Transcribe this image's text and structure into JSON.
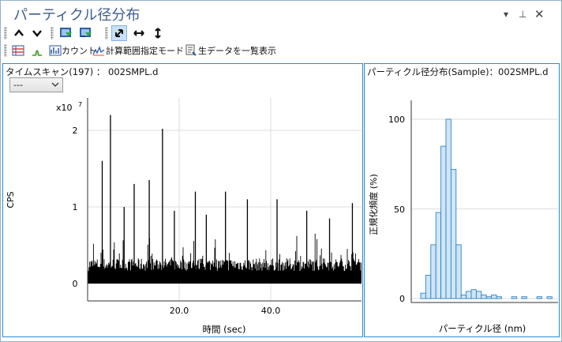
{
  "window": {
    "title": "パーティクル径分布"
  },
  "toolbar1": {
    "items": [
      "up-arrow",
      "down-arrow",
      "export-green",
      "export-blue",
      "autoscale",
      "expand-horizontal",
      "expand-vertical"
    ]
  },
  "toolbar2": {
    "count_label": "カウント",
    "calc_range_label": "計算範囲指定モード",
    "raw_data_label": "生データを一覧表示"
  },
  "time_scan_panel": {
    "title": "タイムスキャン(197) ： 002SMPL.d",
    "dropdown_value": "---",
    "y_label": "CPS",
    "y_multiplier": "x10",
    "y_exponent": "7",
    "x_label": "時間 (sec)",
    "y_ticks": [
      "0",
      "1",
      "2"
    ],
    "x_ticks": [
      "20.0",
      "40.0"
    ]
  },
  "histogram_panel": {
    "title": "パーティクル径分布(Sample)：002SMPL.d",
    "y_label": "正規化頻度 (%)",
    "x_label": "パーティクル径 (nm)",
    "y_ticks": [
      "0",
      "50",
      "100"
    ]
  },
  "chart_data": [
    {
      "type": "line",
      "title": "タイムスキャン(197) ： 002SMPL.d",
      "xlabel": "時間 (sec)",
      "ylabel": "CPS",
      "y_scale_note": "x10^7",
      "xlim": [
        0,
        60
      ],
      "ylim": [
        -0.1,
        2.4
      ],
      "baseline": 0.3,
      "spikes": [
        {
          "x": 5.0,
          "y": 2.2
        },
        {
          "x": 3.2,
          "y": 1.6
        },
        {
          "x": 16.4,
          "y": 2.02
        },
        {
          "x": 13.5,
          "y": 1.35
        },
        {
          "x": 10.2,
          "y": 1.3
        },
        {
          "x": 23.6,
          "y": 1.2
        },
        {
          "x": 30.2,
          "y": 1.2
        },
        {
          "x": 35.0,
          "y": 1.1
        },
        {
          "x": 41.5,
          "y": 1.1
        },
        {
          "x": 58.0,
          "y": 1.05
        },
        {
          "x": 8.0,
          "y": 1.0
        },
        {
          "x": 19.0,
          "y": 0.95
        },
        {
          "x": 26.0,
          "y": 0.9
        },
        {
          "x": 48.0,
          "y": 0.95
        },
        {
          "x": 53.0,
          "y": 0.85
        }
      ]
    },
    {
      "type": "bar",
      "title": "パーティクル径分布(Sample)：002SMPL.d",
      "xlabel": "パーティクル径 (nm)",
      "ylabel": "正規化頻度 (%)",
      "ylim": [
        0,
        120
      ],
      "values": [
        3,
        13,
        30,
        48,
        85,
        100,
        72,
        30,
        2,
        4,
        5,
        4,
        2,
        1,
        2,
        1,
        0,
        0,
        1,
        0,
        1,
        0,
        0,
        1,
        0,
        1
      ],
      "colors": {
        "fill": "#cfe6f7",
        "stroke": "#2f82c4"
      }
    }
  ]
}
